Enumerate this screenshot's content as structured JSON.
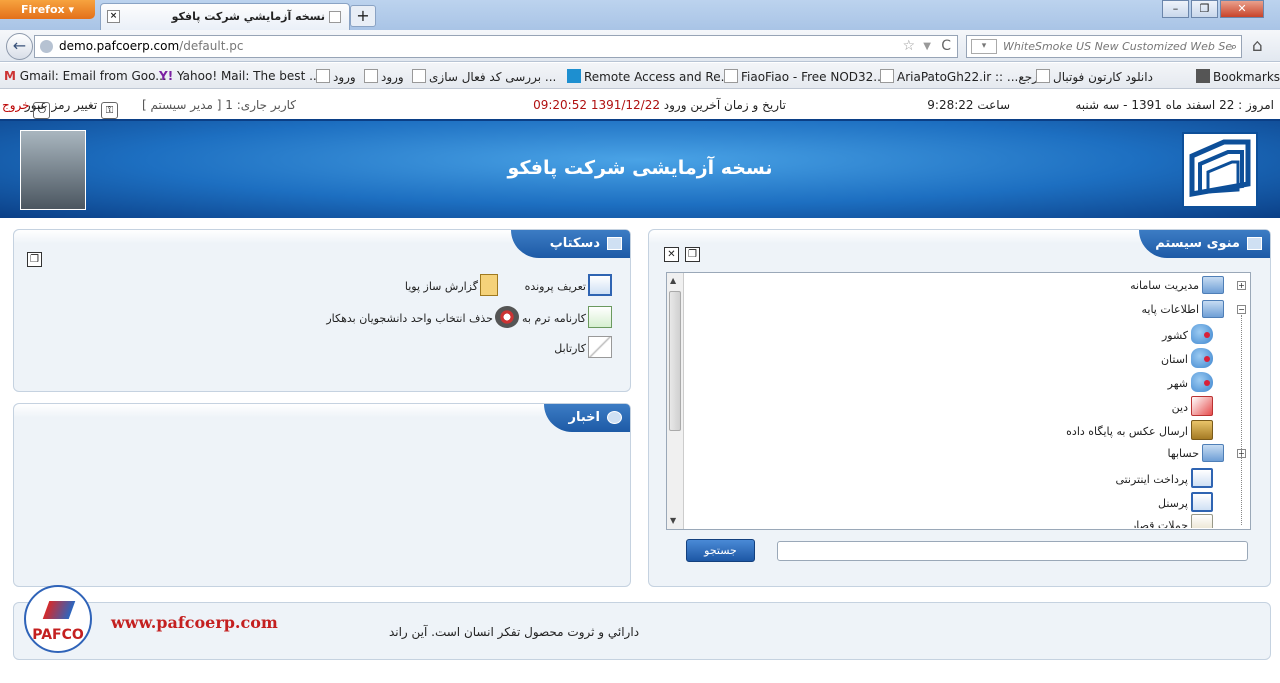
{
  "browser": {
    "menu_button": "Firefox",
    "tab_title": "نسخه آزمايشي شرکت پافکو",
    "tab_close": "×",
    "new_tab": "+",
    "url_domain": "demo.pafcoerp.com",
    "url_path": "/default.pc",
    "url_prefix": "",
    "search_placeholder": "WhiteSmoke US New Customized Web Se",
    "bookmarks": [
      {
        "label": "Gmail: Email from Goo..."
      },
      {
        "label": "Yahoo! Mail: The best ..."
      },
      {
        "label": "ورود"
      },
      {
        "label": "ورود"
      },
      {
        "label": "بررسی کد فعال سازی ..."
      },
      {
        "label": "Remote Access and Re..."
      },
      {
        "label": "FiaoFiao - Free NOD32..."
      },
      {
        "label": "AriaPatoGh22.ir :: ...مرجع"
      },
      {
        "label": "دانلود کارتون فوتبال"
      },
      {
        "label": "Bookmarks"
      }
    ]
  },
  "status": {
    "today": "امروز : 22 اسفند ماه 1391 - سه شنبه",
    "clock": "ساعت 9:28:22",
    "last_login_label": "تاریخ و زمان آخرین ورود :",
    "last_login_value": "1391/12/22 09:20:52",
    "current_user": "کاربر جاری: 1 [ مدیر سیستم ]",
    "change_password": "تغییر رمز عبور",
    "logout": "خروج"
  },
  "banner": {
    "title": "نسخه آزمایشی شرکت پافکو"
  },
  "desktop": {
    "title": "دسکتاپ",
    "items": [
      {
        "label": "تعریف پرونده"
      },
      {
        "label": "گزارش ساز پویا"
      },
      {
        "label": "کارنامه ترم به ترم"
      },
      {
        "label": "حذف انتخاب واحد دانشجویان بدهکار"
      },
      {
        "label": "کارتابل"
      }
    ]
  },
  "news": {
    "title": "اخبار"
  },
  "system_menu": {
    "title": "منوی سیستم",
    "tree": [
      {
        "label": "مدیریت سامانه"
      },
      {
        "label": "اطلاعات پایه"
      },
      {
        "label": "کشور"
      },
      {
        "label": "استان"
      },
      {
        "label": "شهر"
      },
      {
        "label": "دین"
      },
      {
        "label": "ارسال عکس به پایگاه داده"
      },
      {
        "label": "حسابها"
      },
      {
        "label": "پرداخت اینترنتی"
      },
      {
        "label": "پرسنل"
      },
      {
        "label": "جملات قصار"
      }
    ],
    "search_button": "جستجو",
    "search_value": ""
  },
  "footer": {
    "logo_text": "PAFCO",
    "url": "www.pafcoerp.com",
    "quote": "دارائي و ثروت محصول تفکر انسان است. آين راند"
  }
}
